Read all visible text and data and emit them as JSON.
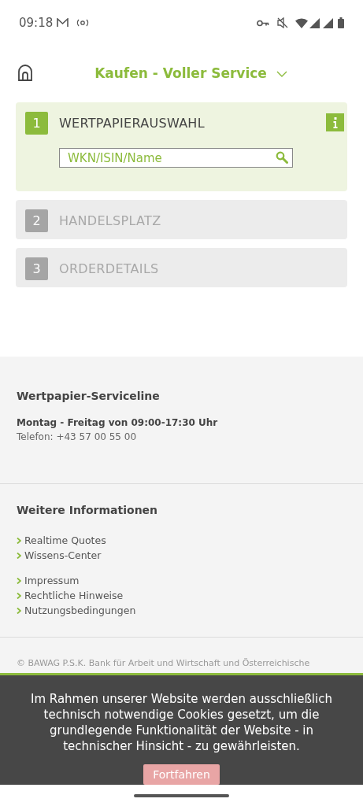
{
  "status_bar": {
    "time": "09:18"
  },
  "header": {
    "title": "Kaufen - Voller Service"
  },
  "steps": [
    {
      "number": "1",
      "label": "WERTPAPIERAUSWAHL",
      "active": true,
      "search": {
        "placeholder": "WKN/ISIN/Name"
      }
    },
    {
      "number": "2",
      "label": "HANDELSPLATZ",
      "active": false
    },
    {
      "number": "3",
      "label": "ORDERDETAILS",
      "active": false
    }
  ],
  "footer": {
    "serviceline": {
      "title": "Wertpapier-Serviceline",
      "hours": "Montag - Freitag von 09:00-17:30 Uhr",
      "phone": "Telefon: +43 57 00 55 00"
    },
    "info": {
      "title": "Weitere Informationen",
      "groups": [
        [
          "Realtime Quotes",
          "Wissens-Center"
        ],
        [
          "Impressum",
          "Rechtliche Hinweise",
          "Nutzungsbedingungen"
        ]
      ]
    },
    "copyright": [
      "© BAWAG P.S.K. Bank für Arbeit und Wirtschaft und Österreichische"
    ]
  },
  "cookie_banner": {
    "text": "Im Rahmen unserer Website werden ausschließlich technisch notwendige Cookies gesetzt, um die grundlegende Funktionalität der Website - in technischer Hinsicht - zu gewährleisten.",
    "button": "Fortfahren"
  }
}
